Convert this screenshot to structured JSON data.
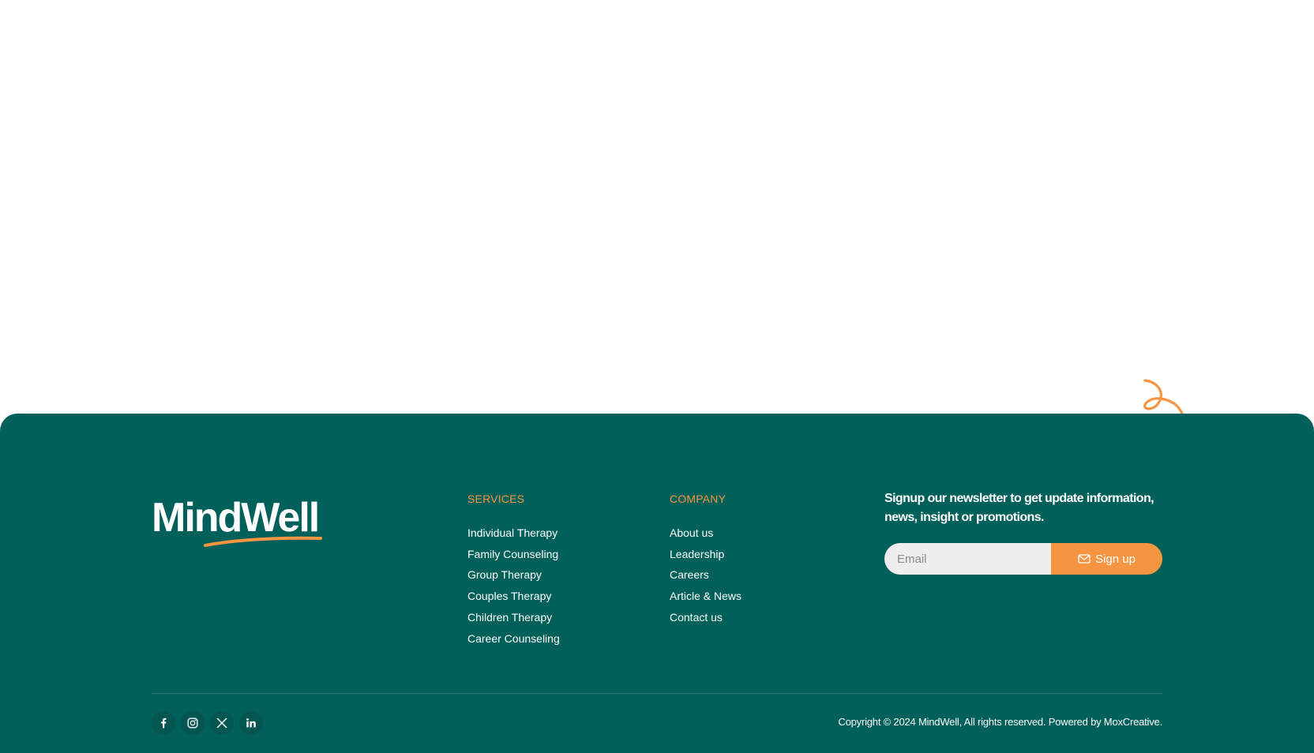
{
  "brand": {
    "name": "MindWell",
    "colors": {
      "footer_bg": "#02605b",
      "accent": "#f59542",
      "text": "#ffffff"
    }
  },
  "footer": {
    "services": {
      "heading": "SERVICES",
      "items": [
        "Individual Therapy",
        "Family Counseling",
        "Group Therapy",
        "Couples Therapy",
        "Children Therapy",
        "Career Counseling"
      ]
    },
    "company": {
      "heading": "COMPANY",
      "items": [
        "About us",
        "Leadership",
        "Careers",
        "Article & News",
        "Contact us"
      ]
    },
    "newsletter": {
      "text": "Signup our newsletter to get update information, news, insight or promotions.",
      "email_placeholder": "Email",
      "email_value": "",
      "button_label": "Sign up",
      "button_icon": "mail-icon"
    },
    "socials": [
      {
        "icon": "facebook-icon"
      },
      {
        "icon": "instagram-icon"
      },
      {
        "icon": "x-icon"
      },
      {
        "icon": "linkedin-icon"
      }
    ],
    "copyright": "Copyright © 2024 MindWell, All rights reserved. Powered by MoxCreative."
  }
}
